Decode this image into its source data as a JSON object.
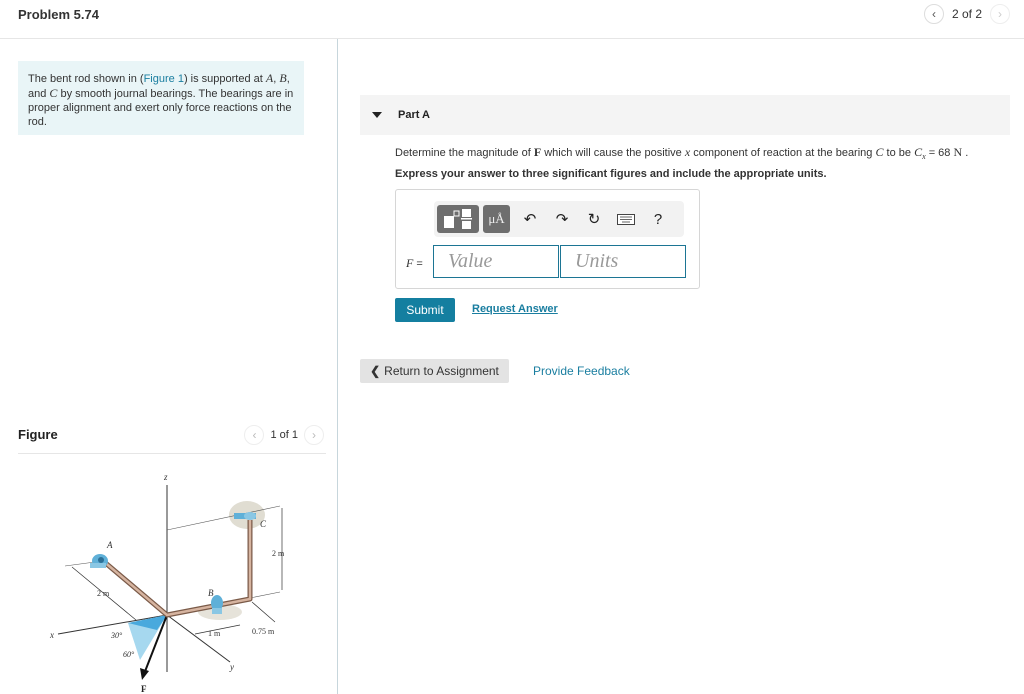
{
  "header": {
    "title": "Problem 5.74",
    "pager_text": "2 of 2",
    "prev_icon": "chevron-left-icon",
    "next_icon": "chevron-right-icon"
  },
  "intro": {
    "text_before_link": "The bent rod shown in (",
    "link": "Figure 1",
    "text_after_link": ") is supported at ",
    "A": "A",
    "B": "B",
    "C": "C",
    "text_line2": " by smooth journal bearings. The bearings are in proper alignment and exert only force reactions on the rod.",
    "and": ", and "
  },
  "figure": {
    "title": "Figure",
    "pager_text": "1 of 1",
    "labels": {
      "z": "z",
      "x": "x",
      "y": "y",
      "A": "A",
      "B": "B",
      "C": "C",
      "F": "F",
      "dim_2m_left": "2 m",
      "dim_2m_right": "2 m",
      "dim_1m": "1 m",
      "dim_075m": "0.75 m",
      "angle_30": "30°",
      "angle_60": "60°"
    }
  },
  "part": {
    "label": "Part A",
    "question_pre": "Determine the magnitude of ",
    "question_F": "F",
    "question_mid": " which will cause the positive ",
    "question_x": "x",
    "question_mid2": " component of reaction at the bearing ",
    "question_C": "C",
    "question_mid3": " to be ",
    "question_Cx": "C",
    "question_sub": "x",
    "question_val": " = 68 ",
    "question_unit": "N",
    "question_end": " .",
    "instruction": "Express your answer to three significant figures and include the appropriate units.",
    "toolbar": {
      "units_label": "μÅ",
      "undo_icon": "undo-icon",
      "redo_icon": "redo-icon",
      "reset_icon": "reset-icon",
      "keyboard_icon": "keyboard-icon",
      "help_label": "?"
    },
    "f_label": "F",
    "f_eq": " =",
    "value_placeholder": "Value",
    "units_placeholder": "Units",
    "submit": "Submit",
    "request_answer": "Request Answer"
  },
  "footer": {
    "return": "Return to Assignment",
    "feedback": "Provide Feedback"
  },
  "colors": {
    "accent": "#147fa0",
    "link": "#1a7ea0",
    "intro_bg": "#e9f5f7"
  }
}
